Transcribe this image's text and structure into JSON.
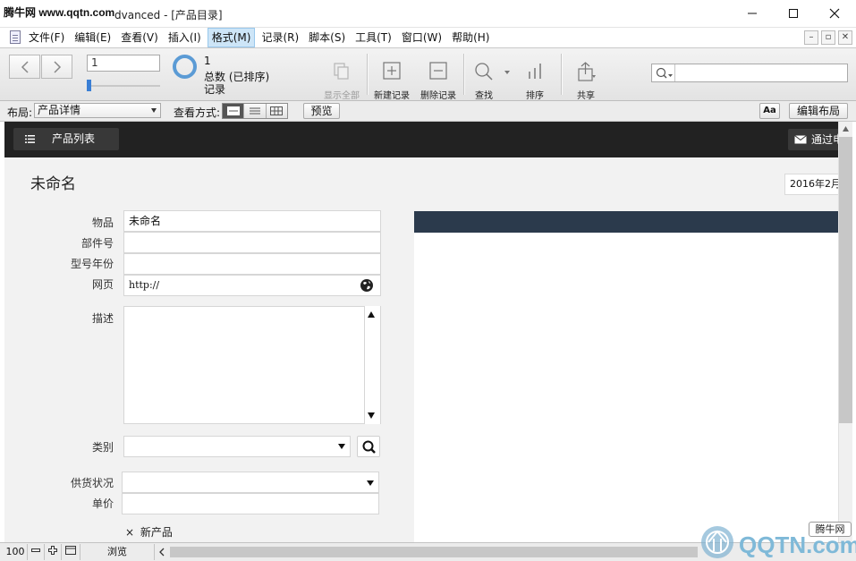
{
  "watermark": {
    "site_text": "腾牛网 www.qqtn.com",
    "logo_text": "QQTN.com",
    "badge_text": "腾牛网"
  },
  "window": {
    "title": "dvanced - [产品目录]",
    "controls": {
      "minimize": "—",
      "maximize": "☐",
      "close": "✕"
    }
  },
  "menu": {
    "items": [
      "文件(F)",
      "编辑(E)",
      "查看(V)",
      "插入(I)",
      "格式(M)",
      "记录(R)",
      "脚本(S)",
      "工具(T)",
      "窗口(W)",
      "帮助(H)"
    ],
    "active_index": 4,
    "mdi_controls": [
      "–",
      "▫",
      "✕"
    ]
  },
  "toolbar": {
    "back_icon": "chevron-left-icon",
    "forward_icon": "chevron-right-icon",
    "record_number": "1",
    "record_count": "1",
    "total_label": "总数 (已排序)",
    "records_label": "记录",
    "buttons": {
      "show_all": "显示全部",
      "new_record": "新建记录",
      "delete_record": "删除记录",
      "find": "查找",
      "sort": "排序",
      "share": "共享"
    },
    "search_value": ""
  },
  "layoutbar": {
    "layout_label": "布局:",
    "layout_value": "产品详情",
    "view_label": "查看方式:",
    "preview_label": "预览",
    "font_button": "Aa",
    "edit_layout": "编辑布局"
  },
  "header": {
    "list_button": "产品列表",
    "mail_button": "通过电"
  },
  "record": {
    "title": "未命名",
    "date": "2016年2月",
    "fields": {
      "item": {
        "label": "物品",
        "value": "未命名"
      },
      "part_no": {
        "label": "部件号",
        "value": ""
      },
      "model_year": {
        "label": "型号年份",
        "value": ""
      },
      "webpage": {
        "label": "网页",
        "value": "http://"
      },
      "description": {
        "label": "描述",
        "value": ""
      },
      "category": {
        "label": "类别",
        "value": ""
      },
      "supply_status": {
        "label": "供货状况",
        "value": ""
      },
      "unit_price": {
        "label": "单价",
        "value": ""
      },
      "new_product": {
        "label": "新产品",
        "checked_mark": "×"
      }
    }
  },
  "statusbar": {
    "zoom": "100",
    "mode": "浏览"
  },
  "colors": {
    "accent": "#3a7fd5",
    "dark_header": "#222222",
    "panel_header": "#2b3a4c",
    "content_bg": "#f2f2f2"
  }
}
